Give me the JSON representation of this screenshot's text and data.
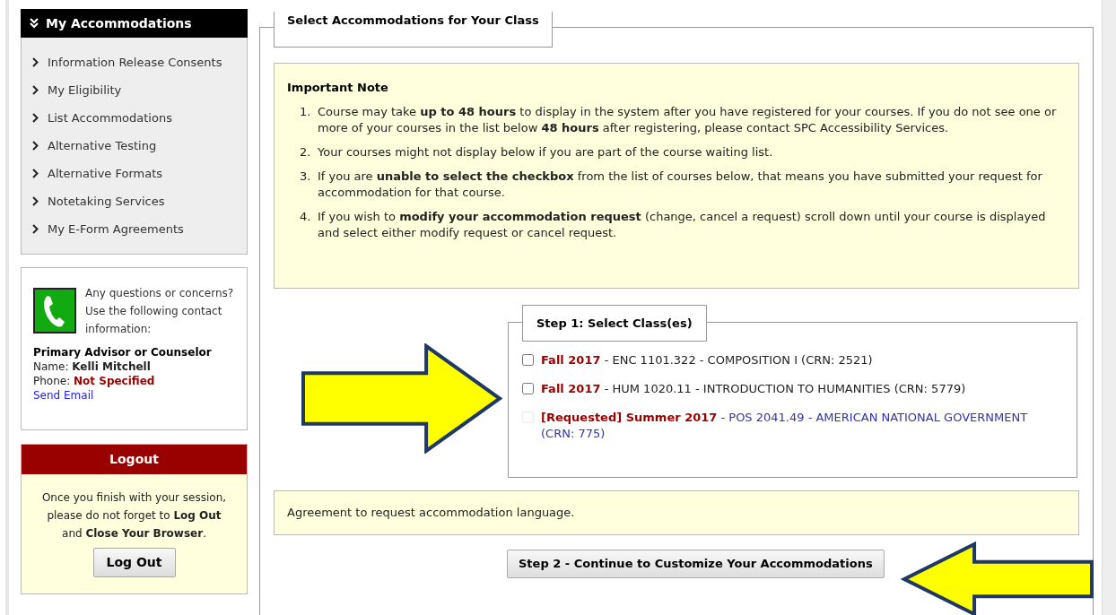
{
  "sidebar": {
    "title": "My Accommodations",
    "items": [
      {
        "label": "Information Release Consents"
      },
      {
        "label": "My Eligibility"
      },
      {
        "label": "List Accommodations"
      },
      {
        "label": "Alternative Testing"
      },
      {
        "label": "Alternative Formats"
      },
      {
        "label": "Notetaking Services"
      },
      {
        "label": "My E-Form Agreements"
      }
    ]
  },
  "contact": {
    "intro": "Any questions or concerns? Use the following contact information:",
    "heading": "Primary Advisor or Counselor",
    "name": "Name: **Kelli Mitchell**",
    "phone": "Phone: **Not Specified**",
    "email_link": "Send Email"
  },
  "logout": {
    "title": "Logout",
    "message": "Once you finish with your session, please do not forget to **Log Out** and **Close Your Browser**.",
    "button": "Log Out"
  },
  "main": {
    "legend": "Select Accommodations for Your Class",
    "note": {
      "title": "Important Note",
      "items": [
        {
          "number": "1.",
          "text": "Course may take **up to 48 hours** to display in the system after you have registered for your courses. If you do not see one or more of your courses in the list below **48 hours** after registering, please contact SPC Accessibility Services."
        },
        {
          "number": "2.",
          "text": "Your courses might not display below if you are part of the course waiting list."
        },
        {
          "number": "3.",
          "text": "If you are **unable to select the checkbox** from the list of courses below, that means you have submitted your request for accommodation for that course."
        },
        {
          "number": "4.",
          "text": "If you wish to **modify your accommodation request** (change, cancel a request) scroll down until your course is displayed and select either modify request or cancel request."
        }
      ]
    },
    "step1": {
      "legend": "Step 1: Select Class(es)",
      "courses": [
        {
          "text": "**Fall 2017** - ENC 1101.322 - COMPOSITION I (CRN: 2521)",
          "checked": false,
          "disabled": false
        },
        {
          "text": "**Fall 2017** - HUM 1020.11 - INTRODUCTION TO HUMANITIES (CRN: 5779)",
          "checked": false,
          "disabled": false
        },
        {
          "text": "**[Requested] Summer 2017** - POS 2041.49 - AMERICAN NATIONAL GOVERNMENT (CRN: 775)",
          "checked": false,
          "disabled": true
        }
      ]
    },
    "agreement": "Agreement to request accommodation language.",
    "step2_button": "Step 2 - Continue to Customize Your Accommodations"
  }
}
